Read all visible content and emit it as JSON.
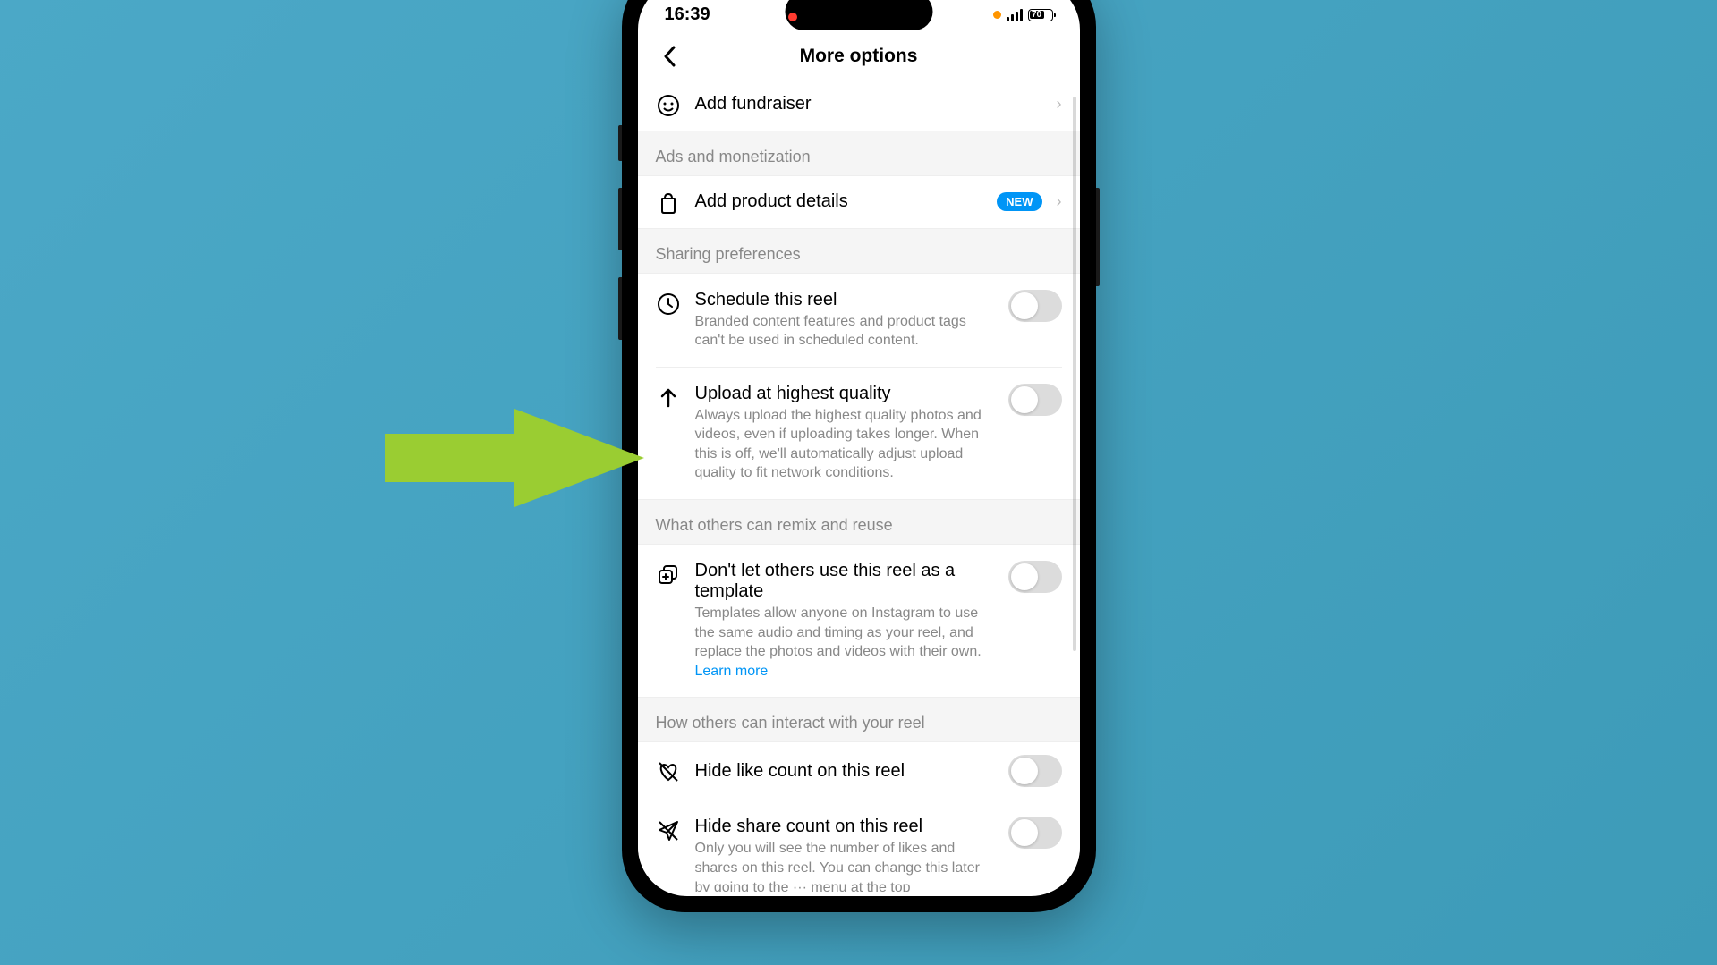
{
  "status": {
    "time": "16:39",
    "battery": "70"
  },
  "header": {
    "title": "More options"
  },
  "fundraiser": {
    "label": "Add fundraiser"
  },
  "sections": {
    "ads": {
      "header": "Ads and monetization",
      "product_details": "Add product details",
      "badge": "NEW"
    },
    "sharing": {
      "header": "Sharing preferences",
      "schedule": {
        "title": "Schedule this reel",
        "desc": "Branded content features and product tags can't be used in scheduled content."
      },
      "upload": {
        "title": "Upload at highest quality",
        "desc": "Always upload the highest quality photos and videos, even if uploading takes longer. When this is off, we'll automatically adjust upload quality to fit network conditions."
      }
    },
    "remix": {
      "header": "What others can remix and reuse",
      "template": {
        "title": "Don't let others use this reel as a template",
        "desc": "Templates allow anyone on Instagram to use the same audio and timing as your reel, and replace the photos and videos with their own. ",
        "link": "Learn more"
      }
    },
    "interact": {
      "header": "How others can interact with your reel",
      "hide_likes": {
        "title": "Hide like count on this reel"
      },
      "hide_shares": {
        "title": "Hide share count on this reel",
        "desc": "Only you will see the number of likes and shares on this reel. You can change this later by going to the ··· menu at the top"
      }
    }
  }
}
